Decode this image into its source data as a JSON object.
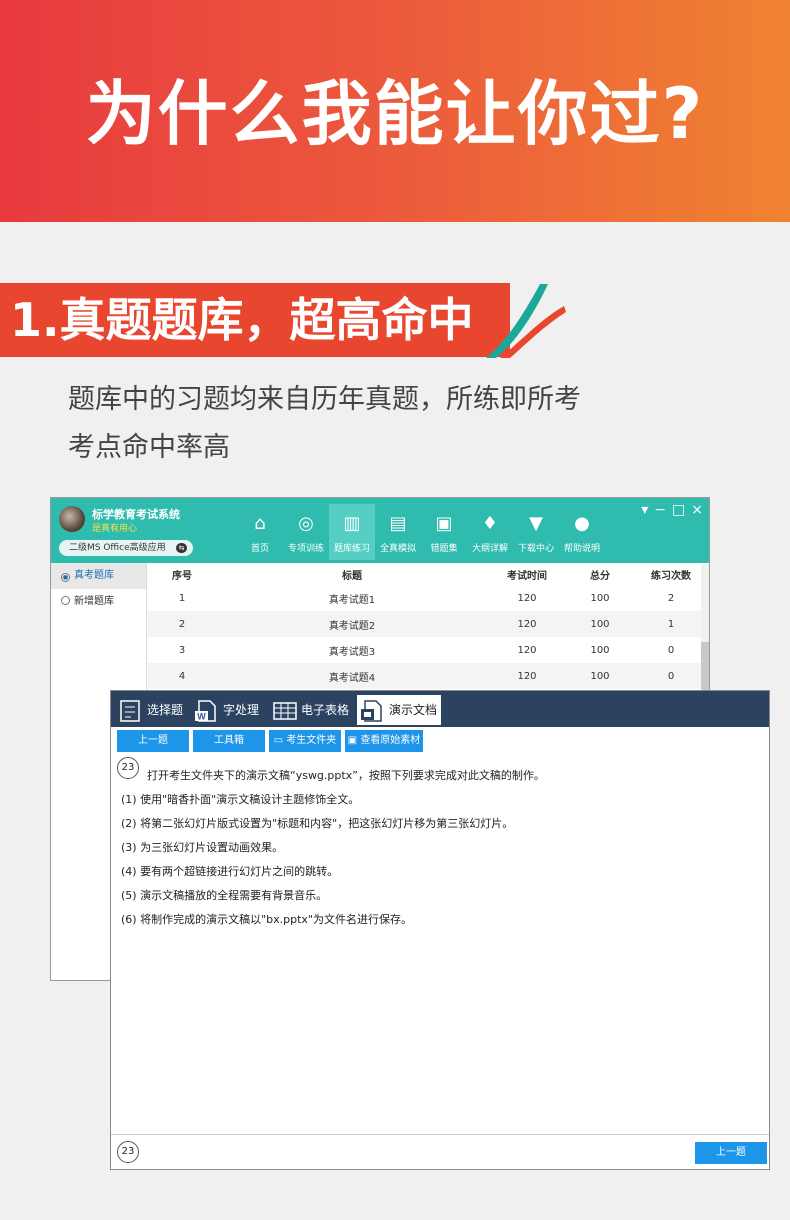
{
  "banner": {
    "title": "为什么我能让你过?"
  },
  "section": {
    "heading": "1.真题题库，超高命中",
    "desc_line1": "题库中的习题均来自历年真题，所练即所考",
    "desc_line2": "考点命中率高"
  },
  "app": {
    "title": "标学教育考试系统",
    "subtitle": "是真有用心",
    "level": "二级MS Office高级应用",
    "nav": [
      {
        "label": "首页",
        "icon": "home-icon"
      },
      {
        "label": "专项训练",
        "icon": "target-icon"
      },
      {
        "label": "题库练习",
        "icon": "books-icon"
      },
      {
        "label": "全真模拟",
        "icon": "clipboard-icon"
      },
      {
        "label": "错题集",
        "icon": "error-book-icon"
      },
      {
        "label": "大纲详解",
        "icon": "graduation-cap-icon"
      },
      {
        "label": "下载中心",
        "icon": "download-icon"
      },
      {
        "label": "帮助说明",
        "icon": "lightbulb-icon"
      }
    ],
    "sidebar": [
      {
        "label": "真考题库"
      },
      {
        "label": "新增题库"
      }
    ],
    "table": {
      "headers": [
        "序号",
        "标题",
        "考试时间",
        "总分",
        "练习次数"
      ],
      "rows": [
        [
          "1",
          "真考试题1",
          "120",
          "100",
          "2"
        ],
        [
          "2",
          "真考试题2",
          "120",
          "100",
          "1"
        ],
        [
          "3",
          "真考试题3",
          "120",
          "100",
          "0"
        ],
        [
          "4",
          "真考试题4",
          "120",
          "100",
          "0"
        ]
      ]
    }
  },
  "exam": {
    "tabs": [
      "选择题",
      "字处理",
      "电子表格",
      "演示文档"
    ],
    "toolbar": {
      "prev": "上一题",
      "tools": "工具箱",
      "folder": "考生文件夹",
      "view": "查看原始素材"
    },
    "question_number": "23",
    "intro": "打开考生文件夹下的演示文稿“yswg.pptx”，按照下列要求完成对此文稿的制作。",
    "items": [
      "(1) 使用\"暗香扑面\"演示文稿设计主题修饰全文。",
      "(2) 将第二张幻灯片版式设置为\"标题和内容\"，把这张幻灯片移为第三张幻灯片。",
      "(3) 为三张幻灯片设置动画效果。",
      "(4) 要有两个超链接进行幻灯片之间的跳转。",
      "(5) 演示文稿播放的全程需要有背景音乐。",
      "(6) 将制作完成的演示文稿以\"bx.pptx\"为文件名进行保存。"
    ],
    "footer_number": "23",
    "footer_prev": "上一题"
  }
}
